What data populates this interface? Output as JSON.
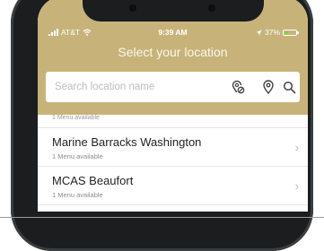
{
  "statusbar": {
    "carrier": "AT&T",
    "time": "9:39 AM",
    "battery": "37%",
    "battery_level": 0.37
  },
  "header": {
    "title": "Select your location"
  },
  "search": {
    "placeholder": "Search location name",
    "icons": [
      "location-off-icon",
      "map-pin-icon",
      "search-icon"
    ]
  },
  "locations": [
    {
      "sub": "1 Menu available"
    },
    {
      "name": "Marine Barracks Washington",
      "sub": "1 Menu available"
    },
    {
      "name": "MCAS Beaufort",
      "sub": "1 Menu available"
    }
  ],
  "colors": {
    "header": "#c7b37a",
    "frame": "#1b1d1f",
    "battery_fill": "#6ddc3d"
  }
}
